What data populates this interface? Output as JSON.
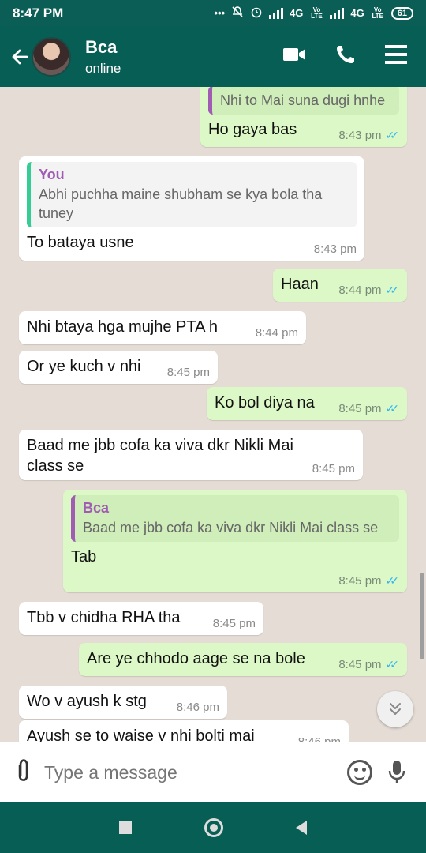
{
  "status_bar": {
    "time": "8:47 PM",
    "dots": "•••",
    "network_1": "4G",
    "network_2": "4G",
    "volte_1": "Vo LTE",
    "volte_2": "Vo LTE",
    "battery": "61"
  },
  "header": {
    "contact_name": "Bca",
    "contact_status": "online",
    "icons": [
      "back-arrow-icon",
      "video-call-icon",
      "phone-icon",
      "menu-icon"
    ]
  },
  "messages": [
    {
      "dir": "out",
      "quote_text": "Nhi to Mai suna dugi hnhe",
      "text": "Ho gaya bas",
      "time": "8:43 pm",
      "ticks": "✓✓"
    },
    {
      "dir": "in",
      "quote_name": "You",
      "quote_text": "Abhi puchha maine shubham se kya bola tha tuney",
      "text": "To bataya usne",
      "time": "8:43 pm"
    },
    {
      "dir": "out",
      "text": "Haan",
      "time": "8:44 pm",
      "ticks": "✓✓"
    },
    {
      "dir": "in",
      "text": "Nhi btaya hga mujhe PTA h",
      "time": "8:44 pm"
    },
    {
      "dir": "in",
      "text": "Or ye kuch v nhi",
      "time": "8:45 pm"
    },
    {
      "dir": "out",
      "text": "Ko bol diya na",
      "time": "8:45 pm",
      "ticks": "✓✓"
    },
    {
      "dir": "in",
      "text": "Baad me jbb cofa ka viva dkr Nikli Mai class se",
      "time": "8:45 pm"
    },
    {
      "dir": "out",
      "quote_name": "Bca",
      "quote_text": "Baad me jbb cofa ka viva dkr Nikli Mai class se",
      "text": "Tab",
      "time": "8:45 pm",
      "ticks": "✓✓"
    },
    {
      "dir": "in",
      "text": "Tbb v chidha RHA tha",
      "time": "8:45 pm"
    },
    {
      "dir": "out",
      "text": "Are ye chhodo aage se na bole",
      "time": "8:45 pm",
      "ticks": "✓✓"
    },
    {
      "dir": "in",
      "text": "Wo v ayush k stg",
      "time": "8:46 pm"
    },
    {
      "dir": "in",
      "text": "Ayush se to waise v nhi bolti mai",
      "time": "8:46 pm"
    }
  ],
  "input": {
    "placeholder": "Type a message"
  },
  "colors": {
    "header": "#075e54",
    "outgoing_bubble": "#dcf8c6",
    "incoming_bubble": "#ffffff",
    "read_ticks": "#34b7f1",
    "chat_background": "#e5ddd5"
  }
}
